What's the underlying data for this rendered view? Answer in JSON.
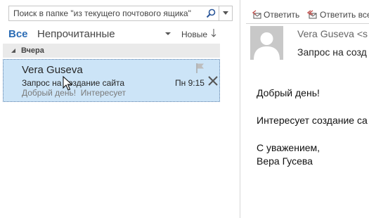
{
  "search": {
    "placeholder": "Поиск в папке \"из текущего почтового ящика\""
  },
  "filters": {
    "all_label": "Все",
    "unread_label": "Непрочитанные",
    "sort_label": "Новые",
    "accent_color": "#2b6cb5"
  },
  "group": {
    "label": "Вчера"
  },
  "message": {
    "sender": "Vera Guseva",
    "subject": "Запрос на создание сайта",
    "preview": "Добрый день!  Интересует",
    "time": "Пн 9:15",
    "selected_bg": "#cce4f7"
  },
  "reading_pane": {
    "reply_label": "Ответить",
    "reply_all_label": "Ответить все",
    "from": "Vera Guseva <s",
    "subject": "Запрос на созд",
    "body": {
      "greeting": "Добрый день!",
      "line": "Интересует создание са",
      "closing": "С уважением,",
      "signature": "Вера Гусева"
    }
  }
}
